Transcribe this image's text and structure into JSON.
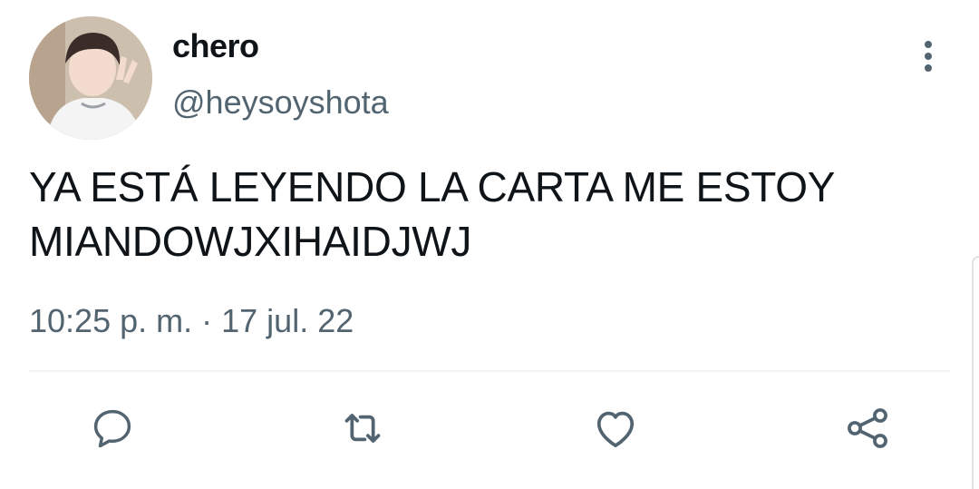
{
  "tweet": {
    "display_name": "chero",
    "handle": "@heysoyshota",
    "text_line1": "YA ESTÁ LEYENDO LA CARTA ME ESTOY",
    "text_line2": "MIANDOWJXIHAIDJWJ",
    "time": "10:25 p. m.",
    "separator": "·",
    "date": "17 jul. 22"
  },
  "icons": {
    "more": "more-vertical-icon",
    "reply": "reply-icon",
    "retweet": "retweet-icon",
    "like": "heart-icon",
    "share": "share-icon"
  },
  "colors": {
    "text": "#0f1419",
    "secondary": "#536471",
    "divider": "#eff3f4"
  }
}
